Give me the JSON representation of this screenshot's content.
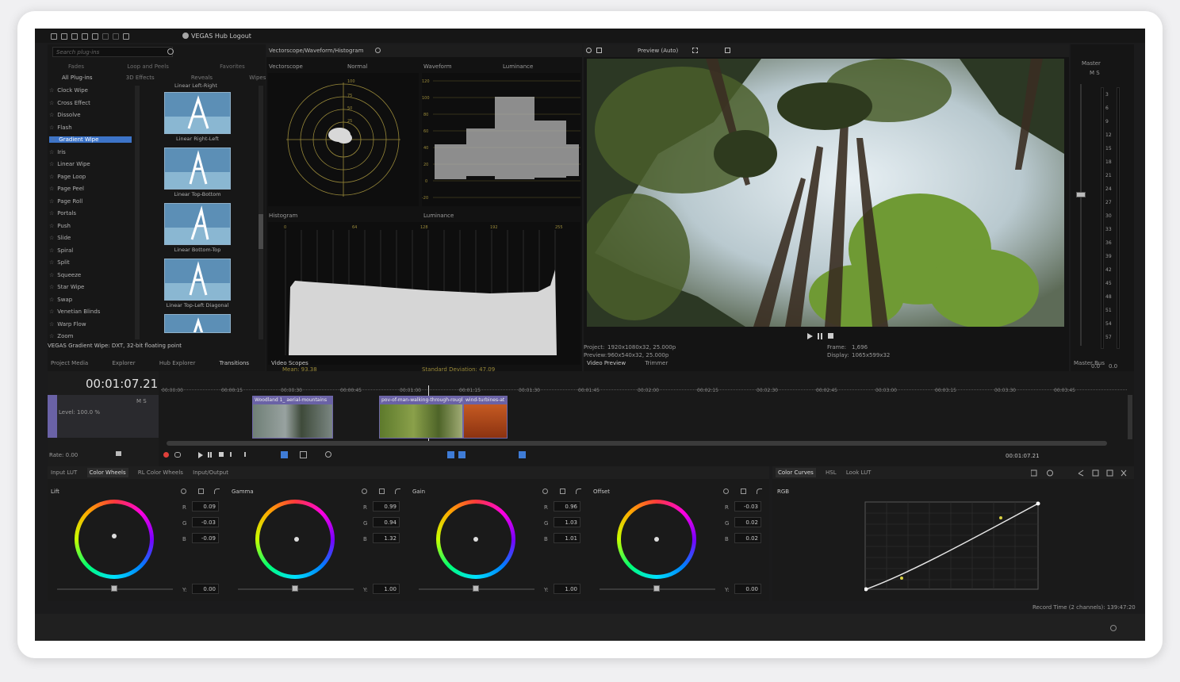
{
  "titlebar": {
    "title": "VEGAS Hub Logout"
  },
  "plugins": {
    "search_placeholder": "Search plug-ins",
    "categories_row1": [
      "Fades",
      "Loop and Peels",
      "Favorites"
    ],
    "categories_row2": [
      "All Plug-ins",
      "3D Effects",
      "Reveals",
      "Wipes"
    ],
    "items": [
      "Clock Wipe",
      "Cross Effect",
      "Dissolve",
      "Flash",
      "Gradient Wipe",
      "Iris",
      "Linear Wipe",
      "Page Loop",
      "Page Peel",
      "Page Roll",
      "Portals",
      "Push",
      "Slide",
      "Spiral",
      "Split",
      "Squeeze",
      "Star Wipe",
      "Swap",
      "Venetian Blinds",
      "Warp Flow",
      "Zoom"
    ],
    "selected_index": 4,
    "presets_top_label": "Linear Left-Right",
    "presets": [
      "Linear Right-Left",
      "Linear Top-Bottom",
      "Linear Bottom-Top",
      "Linear Top-Left Diagonal"
    ],
    "status": "VEGAS Gradient Wipe: DXT, 32-bit floating point"
  },
  "left_tabs": [
    "Project Media",
    "Explorer",
    "Hub Explorer",
    "Transitions"
  ],
  "scopes": {
    "title": "Vectorscope/Waveform/Histogram",
    "vectorscope_label": "Vectorscope",
    "vectorscope_mode": "Normal",
    "vectorscope_ticks": [
      "100",
      "75",
      "50",
      "25"
    ],
    "waveform_label": "Waveform",
    "waveform_mode": "Luminance",
    "waveform_ticks": [
      "120",
      "100",
      "80",
      "60",
      "40",
      "20",
      "0",
      "-20"
    ],
    "histogram_label": "Histogram",
    "histogram_mode": "Luminance",
    "histogram_ticks": [
      "0",
      "64",
      "128",
      "192",
      "255"
    ],
    "mean": "Mean: 93.38",
    "std": "Standard Deviation: 47.09",
    "tab": "Video Scopes"
  },
  "preview": {
    "mode": "Preview (Auto)",
    "project": "Project:",
    "project_val": "1920x1080x32, 25.000p",
    "preview": "Preview:",
    "preview_val": "960x540x32, 25.000p",
    "frame": "Frame:",
    "frame_val": "1,696",
    "display": "Display:",
    "display_val": "1065x599x32",
    "tabs": [
      "Video Preview",
      "Trimmer"
    ]
  },
  "master": {
    "label": "Master",
    "ms": "M  S",
    "scale": [
      "3",
      "6",
      "9",
      "12",
      "15",
      "18",
      "21",
      "24",
      "27",
      "30",
      "33",
      "36",
      "39",
      "42",
      "45",
      "48",
      "51",
      "54",
      "57"
    ],
    "bottom": [
      "0.0",
      "0.0"
    ],
    "tab": "Master Bus"
  },
  "timeline": {
    "timecode": "00:01:07.21",
    "level": "Level: 100.0 %",
    "track_ms": "M  S",
    "rate": "Rate: 0.00",
    "ruler": [
      "00:00:00",
      "00:00:15",
      "00:00:30",
      "00:00:45",
      "00:01:00",
      "00:01:15",
      "00:01:30",
      "00:01:45",
      "00:02:00",
      "00:02:15",
      "00:02:30",
      "00:02:45",
      "00:03:00",
      "00:03:15",
      "00:03:30",
      "00:03:45"
    ],
    "clips": [
      "Woodland 1_ aerial-mountains",
      "pov-of-man-walking-through-rough-dust",
      "wind-turbines-at"
    ],
    "end_time": "00:01:07.21"
  },
  "color": {
    "tabs": [
      "Input LUT",
      "Color Wheels",
      "RL Color Wheels",
      "Input/Output"
    ],
    "active_tab": "Color Wheels",
    "wheels": [
      {
        "name": "Lift",
        "R": "0.09",
        "G": "-0.03",
        "B": "-0.09",
        "Y": "0.00"
      },
      {
        "name": "Gamma",
        "R": "0.99",
        "G": "0.94",
        "B": "1.32",
        "Y": "1.00"
      },
      {
        "name": "Gain",
        "R": "0.96",
        "G": "1.03",
        "B": "1.01",
        "Y": "1.00"
      },
      {
        "name": "Offset",
        "R": "-0.03",
        "G": "0.02",
        "B": "0.02",
        "Y": "0.00"
      }
    ],
    "curves_tabs": [
      "Color Curves",
      "HSL",
      "Look LUT"
    ],
    "curves_channel": "RGB",
    "record_time": "Record Time (2 channels): 139:47:20"
  }
}
